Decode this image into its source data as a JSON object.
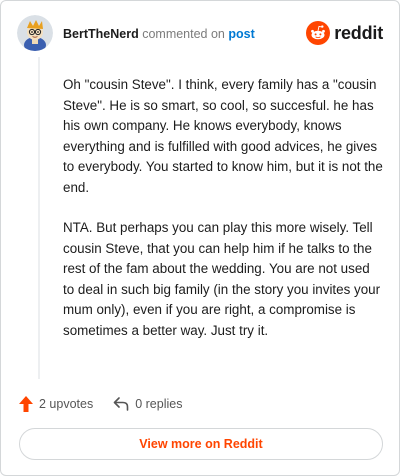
{
  "comment": {
    "username": "BertTheNerd",
    "action_text": "commented on",
    "post_link": "post",
    "paragraphs": [
      "Oh \"cousin Steve\". I think, every family has a \"cousin Steve\". He is so smart, so cool, so succesful. he has his own company. He knows everybody, knows everything and is fulfilled with good advices, he gives to everybody. You started to know him, but it is not the end.",
      "NTA. But perhaps you can play this more wisely. Tell cousin Steve, that you can help him if he talks to the rest of the fam about the wedding. You are not used to deal in such big family (in the story you invites your mum only), even if you are right, a compromise is sometimes a better way. Just try it."
    ]
  },
  "brand": {
    "logo_text": "reddit",
    "color": "#ff4500"
  },
  "actions": {
    "upvotes": "2 upvotes",
    "replies": "0 replies"
  },
  "footer": {
    "view_more": "View more on Reddit"
  },
  "icons": {
    "upvote": "upvote-arrow-icon",
    "reply": "reply-arrow-icon",
    "logo": "reddit-snoo-icon"
  }
}
